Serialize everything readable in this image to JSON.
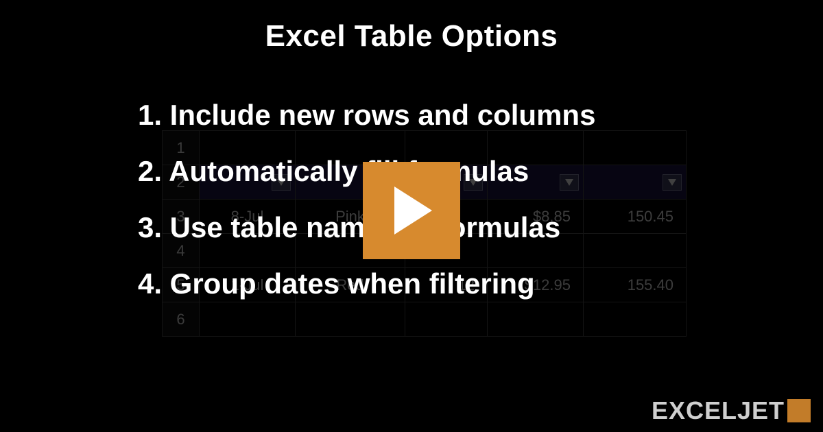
{
  "title": "Excel Table Options",
  "bullets": [
    {
      "num": "1.",
      "text": "Include new rows and columns"
    },
    {
      "num": "2.",
      "text": "Automatically fill formulas"
    },
    {
      "num": "3.",
      "text": "Use table names in formulas"
    },
    {
      "num": "4.",
      "text": "Group dates when filtering"
    }
  ],
  "bg_table": {
    "row_headers": [
      "1",
      "2",
      "3",
      "4",
      "5",
      "6"
    ],
    "rows": [
      [
        "",
        "",
        "",
        "",
        ""
      ],
      [
        "",
        "",
        "",
        "",
        ""
      ],
      [
        "8-Jul",
        "Pink",
        "",
        "$8.85",
        "150.45"
      ],
      [
        "",
        "",
        "",
        "",
        ""
      ],
      [
        "1-Jul",
        "Red",
        "12",
        "$12.95",
        "155.40"
      ],
      [
        "",
        "",
        "",
        "",
        ""
      ]
    ]
  },
  "brand": "EXCELJET",
  "colors": {
    "accent": "#d78a2e"
  }
}
